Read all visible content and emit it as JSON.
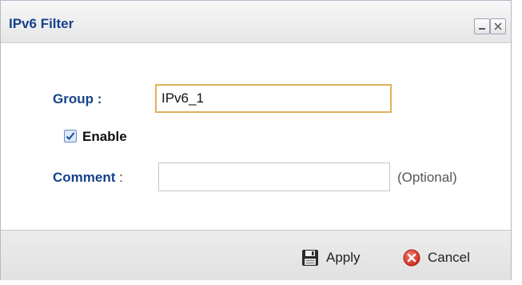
{
  "dialog": {
    "title": "IPv6 Filter",
    "minimize_icon": "minimize-icon",
    "close_icon": "close-icon"
  },
  "form": {
    "group_label": "Group :",
    "group_value": "IPv6_1",
    "enable_label": "Enable",
    "enable_checked": true,
    "comment_label": "Comment",
    "comment_colon": " :",
    "comment_value": "",
    "optional_text": "(Optional)"
  },
  "footer": {
    "apply_label": "Apply",
    "cancel_label": "Cancel",
    "apply_icon": "save-disk-icon",
    "cancel_icon": "red-x-circle-icon"
  },
  "colors": {
    "label_blue": "#15428b",
    "focus_border": "#e0b05c",
    "cancel_red": "#d9382a"
  }
}
